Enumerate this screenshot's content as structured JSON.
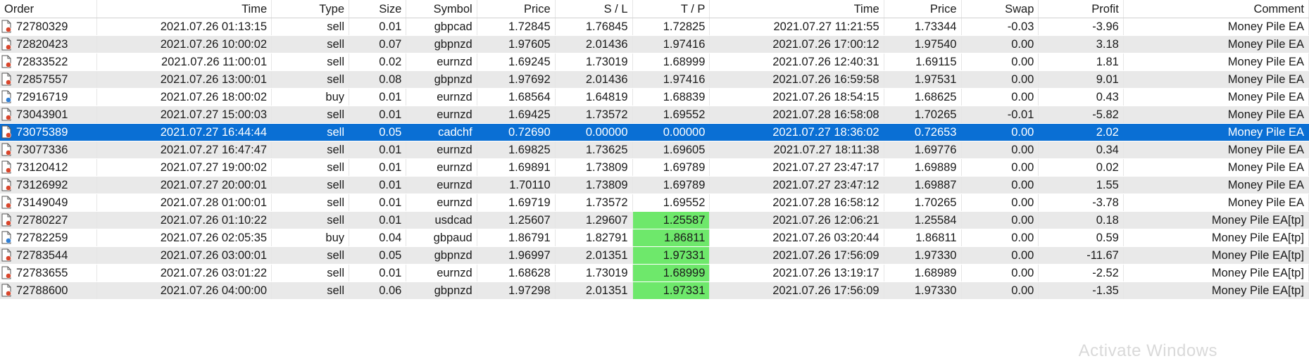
{
  "columns": [
    {
      "key": "order",
      "label": "Order"
    },
    {
      "key": "time",
      "label": "Time"
    },
    {
      "key": "type",
      "label": "Type"
    },
    {
      "key": "size",
      "label": "Size"
    },
    {
      "key": "symbol",
      "label": "Symbol"
    },
    {
      "key": "price",
      "label": "Price"
    },
    {
      "key": "sl",
      "label": "S / L"
    },
    {
      "key": "tp",
      "label": "T / P"
    },
    {
      "key": "close_time",
      "label": "Time"
    },
    {
      "key": "close_price",
      "label": "Price"
    },
    {
      "key": "swap",
      "label": "Swap"
    },
    {
      "key": "profit",
      "label": "Profit"
    },
    {
      "key": "comment",
      "label": "Comment"
    }
  ],
  "colors": {
    "selected_row": "#0a6fd4",
    "tp_hit": "#6ee86b",
    "sell_icon": "#d9452b",
    "buy_icon": "#2f7fd6"
  },
  "rows": [
    {
      "order": "72780329",
      "time": "2021.07.26 01:13:15",
      "type": "sell",
      "size": "0.01",
      "symbol": "gbpcad",
      "price": "1.72845",
      "sl": "1.76845",
      "tp": "1.72825",
      "close_time": "2021.07.27 11:21:55",
      "close_price": "1.73344",
      "swap": "-0.03",
      "profit": "-3.96",
      "comment": "Money Pile EA",
      "tp_hit": false,
      "selected": false
    },
    {
      "order": "72820423",
      "time": "2021.07.26 10:00:02",
      "type": "sell",
      "size": "0.07",
      "symbol": "gbpnzd",
      "price": "1.97605",
      "sl": "2.01436",
      "tp": "1.97416",
      "close_time": "2021.07.26 17:00:12",
      "close_price": "1.97540",
      "swap": "0.00",
      "profit": "3.18",
      "comment": "Money Pile EA",
      "tp_hit": false,
      "selected": false
    },
    {
      "order": "72833522",
      "time": "2021.07.26 11:00:01",
      "type": "sell",
      "size": "0.02",
      "symbol": "eurnzd",
      "price": "1.69245",
      "sl": "1.73019",
      "tp": "1.68999",
      "close_time": "2021.07.26 12:40:31",
      "close_price": "1.69115",
      "swap": "0.00",
      "profit": "1.81",
      "comment": "Money Pile EA",
      "tp_hit": false,
      "selected": false
    },
    {
      "order": "72857557",
      "time": "2021.07.26 13:00:01",
      "type": "sell",
      "size": "0.08",
      "symbol": "gbpnzd",
      "price": "1.97692",
      "sl": "2.01436",
      "tp": "1.97416",
      "close_time": "2021.07.26 16:59:58",
      "close_price": "1.97531",
      "swap": "0.00",
      "profit": "9.01",
      "comment": "Money Pile EA",
      "tp_hit": false,
      "selected": false
    },
    {
      "order": "72916719",
      "time": "2021.07.26 18:00:02",
      "type": "buy",
      "size": "0.01",
      "symbol": "eurnzd",
      "price": "1.68564",
      "sl": "1.64819",
      "tp": "1.68839",
      "close_time": "2021.07.26 18:54:15",
      "close_price": "1.68625",
      "swap": "0.00",
      "profit": "0.43",
      "comment": "Money Pile EA",
      "tp_hit": false,
      "selected": false
    },
    {
      "order": "73043901",
      "time": "2021.07.27 15:00:03",
      "type": "sell",
      "size": "0.01",
      "symbol": "eurnzd",
      "price": "1.69425",
      "sl": "1.73572",
      "tp": "1.69552",
      "close_time": "2021.07.28 16:58:08",
      "close_price": "1.70265",
      "swap": "-0.01",
      "profit": "-5.82",
      "comment": "Money Pile EA",
      "tp_hit": false,
      "selected": false
    },
    {
      "order": "73075389",
      "time": "2021.07.27 16:44:44",
      "type": "sell",
      "size": "0.05",
      "symbol": "cadchf",
      "price": "0.72690",
      "sl": "0.00000",
      "tp": "0.00000",
      "close_time": "2021.07.27 18:36:02",
      "close_price": "0.72653",
      "swap": "0.00",
      "profit": "2.02",
      "comment": "Money Pile EA",
      "tp_hit": false,
      "selected": true
    },
    {
      "order": "73077336",
      "time": "2021.07.27 16:47:47",
      "type": "sell",
      "size": "0.01",
      "symbol": "eurnzd",
      "price": "1.69825",
      "sl": "1.73625",
      "tp": "1.69605",
      "close_time": "2021.07.27 18:11:38",
      "close_price": "1.69776",
      "swap": "0.00",
      "profit": "0.34",
      "comment": "Money Pile EA",
      "tp_hit": false,
      "selected": false
    },
    {
      "order": "73120412",
      "time": "2021.07.27 19:00:02",
      "type": "sell",
      "size": "0.01",
      "symbol": "eurnzd",
      "price": "1.69891",
      "sl": "1.73809",
      "tp": "1.69789",
      "close_time": "2021.07.27 23:47:17",
      "close_price": "1.69889",
      "swap": "0.00",
      "profit": "0.02",
      "comment": "Money Pile EA",
      "tp_hit": false,
      "selected": false
    },
    {
      "order": "73126992",
      "time": "2021.07.27 20:00:01",
      "type": "sell",
      "size": "0.01",
      "symbol": "eurnzd",
      "price": "1.70110",
      "sl": "1.73809",
      "tp": "1.69789",
      "close_time": "2021.07.27 23:47:12",
      "close_price": "1.69887",
      "swap": "0.00",
      "profit": "1.55",
      "comment": "Money Pile EA",
      "tp_hit": false,
      "selected": false
    },
    {
      "order": "73149049",
      "time": "2021.07.28 01:00:01",
      "type": "sell",
      "size": "0.01",
      "symbol": "eurnzd",
      "price": "1.69719",
      "sl": "1.73572",
      "tp": "1.69552",
      "close_time": "2021.07.28 16:58:12",
      "close_price": "1.70265",
      "swap": "0.00",
      "profit": "-3.78",
      "comment": "Money Pile EA",
      "tp_hit": false,
      "selected": false
    },
    {
      "order": "72780227",
      "time": "2021.07.26 01:10:22",
      "type": "sell",
      "size": "0.01",
      "symbol": "usdcad",
      "price": "1.25607",
      "sl": "1.29607",
      "tp": "1.25587",
      "close_time": "2021.07.26 12:06:21",
      "close_price": "1.25584",
      "swap": "0.00",
      "profit": "0.18",
      "comment": "Money Pile EA[tp]",
      "tp_hit": true,
      "selected": false
    },
    {
      "order": "72782259",
      "time": "2021.07.26 02:05:35",
      "type": "buy",
      "size": "0.04",
      "symbol": "gbpaud",
      "price": "1.86791",
      "sl": "1.82791",
      "tp": "1.86811",
      "close_time": "2021.07.26 03:20:44",
      "close_price": "1.86811",
      "swap": "0.00",
      "profit": "0.59",
      "comment": "Money Pile EA[tp]",
      "tp_hit": true,
      "selected": false
    },
    {
      "order": "72783544",
      "time": "2021.07.26 03:00:01",
      "type": "sell",
      "size": "0.05",
      "symbol": "gbpnzd",
      "price": "1.96997",
      "sl": "2.01351",
      "tp": "1.97331",
      "close_time": "2021.07.26 17:56:09",
      "close_price": "1.97330",
      "swap": "0.00",
      "profit": "-11.67",
      "comment": "Money Pile EA[tp]",
      "tp_hit": true,
      "selected": false
    },
    {
      "order": "72783655",
      "time": "2021.07.26 03:01:22",
      "type": "sell",
      "size": "0.01",
      "symbol": "eurnzd",
      "price": "1.68628",
      "sl": "1.73019",
      "tp": "1.68999",
      "close_time": "2021.07.26 13:19:17",
      "close_price": "1.68989",
      "swap": "0.00",
      "profit": "-2.52",
      "comment": "Money Pile EA[tp]",
      "tp_hit": true,
      "selected": false
    },
    {
      "order": "72788600",
      "time": "2021.07.26 04:00:00",
      "type": "sell",
      "size": "0.06",
      "symbol": "gbpnzd",
      "price": "1.97298",
      "sl": "2.01351",
      "tp": "1.97331",
      "close_time": "2021.07.26 17:56:09",
      "close_price": "1.97330",
      "swap": "0.00",
      "profit": "-1.35",
      "comment": "Money Pile EA[tp]",
      "tp_hit": true,
      "selected": false
    }
  ],
  "watermark": "Activate Windows"
}
